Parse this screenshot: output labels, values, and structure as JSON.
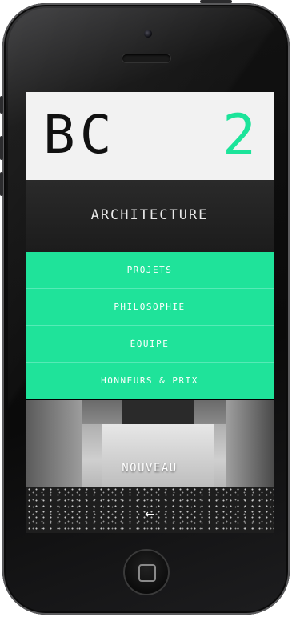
{
  "logo": {
    "left": "BC",
    "right": "2"
  },
  "title": "ARCHITECTURE",
  "menu": {
    "items": [
      {
        "label": "PROJETS"
      },
      {
        "label": "PHILOSOPHIE"
      },
      {
        "label": "ÉQUIPE"
      },
      {
        "label": "HONNEURS & PRIX"
      }
    ]
  },
  "hero": {
    "caption": "NOUVEAU",
    "nav_arrow": "←"
  },
  "colors": {
    "accent": "#1fe39a",
    "logo_accent": "#1ce49a",
    "logo_bar": "#f2f2f2",
    "title_band": "#1c1c1c"
  }
}
